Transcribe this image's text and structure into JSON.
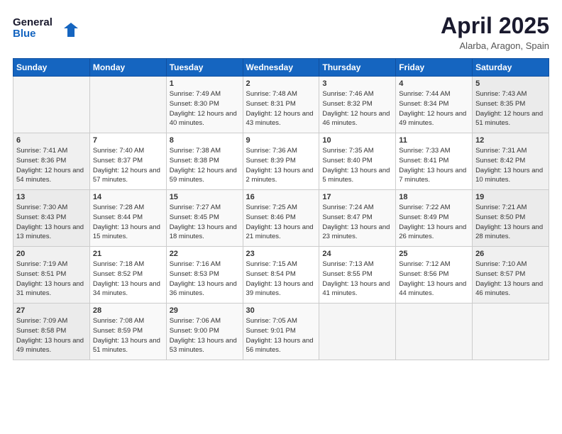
{
  "header": {
    "logo_line1": "General",
    "logo_line2": "Blue",
    "title": "April 2025",
    "subtitle": "Alarba, Aragon, Spain"
  },
  "days_of_week": [
    "Sunday",
    "Monday",
    "Tuesday",
    "Wednesday",
    "Thursday",
    "Friday",
    "Saturday"
  ],
  "weeks": [
    [
      {
        "num": "",
        "info": ""
      },
      {
        "num": "",
        "info": ""
      },
      {
        "num": "1",
        "info": "Sunrise: 7:49 AM\nSunset: 8:30 PM\nDaylight: 12 hours and 40 minutes."
      },
      {
        "num": "2",
        "info": "Sunrise: 7:48 AM\nSunset: 8:31 PM\nDaylight: 12 hours and 43 minutes."
      },
      {
        "num": "3",
        "info": "Sunrise: 7:46 AM\nSunset: 8:32 PM\nDaylight: 12 hours and 46 minutes."
      },
      {
        "num": "4",
        "info": "Sunrise: 7:44 AM\nSunset: 8:34 PM\nDaylight: 12 hours and 49 minutes."
      },
      {
        "num": "5",
        "info": "Sunrise: 7:43 AM\nSunset: 8:35 PM\nDaylight: 12 hours and 51 minutes."
      }
    ],
    [
      {
        "num": "6",
        "info": "Sunrise: 7:41 AM\nSunset: 8:36 PM\nDaylight: 12 hours and 54 minutes."
      },
      {
        "num": "7",
        "info": "Sunrise: 7:40 AM\nSunset: 8:37 PM\nDaylight: 12 hours and 57 minutes."
      },
      {
        "num": "8",
        "info": "Sunrise: 7:38 AM\nSunset: 8:38 PM\nDaylight: 12 hours and 59 minutes."
      },
      {
        "num": "9",
        "info": "Sunrise: 7:36 AM\nSunset: 8:39 PM\nDaylight: 13 hours and 2 minutes."
      },
      {
        "num": "10",
        "info": "Sunrise: 7:35 AM\nSunset: 8:40 PM\nDaylight: 13 hours and 5 minutes."
      },
      {
        "num": "11",
        "info": "Sunrise: 7:33 AM\nSunset: 8:41 PM\nDaylight: 13 hours and 7 minutes."
      },
      {
        "num": "12",
        "info": "Sunrise: 7:31 AM\nSunset: 8:42 PM\nDaylight: 13 hours and 10 minutes."
      }
    ],
    [
      {
        "num": "13",
        "info": "Sunrise: 7:30 AM\nSunset: 8:43 PM\nDaylight: 13 hours and 13 minutes."
      },
      {
        "num": "14",
        "info": "Sunrise: 7:28 AM\nSunset: 8:44 PM\nDaylight: 13 hours and 15 minutes."
      },
      {
        "num": "15",
        "info": "Sunrise: 7:27 AM\nSunset: 8:45 PM\nDaylight: 13 hours and 18 minutes."
      },
      {
        "num": "16",
        "info": "Sunrise: 7:25 AM\nSunset: 8:46 PM\nDaylight: 13 hours and 21 minutes."
      },
      {
        "num": "17",
        "info": "Sunrise: 7:24 AM\nSunset: 8:47 PM\nDaylight: 13 hours and 23 minutes."
      },
      {
        "num": "18",
        "info": "Sunrise: 7:22 AM\nSunset: 8:49 PM\nDaylight: 13 hours and 26 minutes."
      },
      {
        "num": "19",
        "info": "Sunrise: 7:21 AM\nSunset: 8:50 PM\nDaylight: 13 hours and 28 minutes."
      }
    ],
    [
      {
        "num": "20",
        "info": "Sunrise: 7:19 AM\nSunset: 8:51 PM\nDaylight: 13 hours and 31 minutes."
      },
      {
        "num": "21",
        "info": "Sunrise: 7:18 AM\nSunset: 8:52 PM\nDaylight: 13 hours and 34 minutes."
      },
      {
        "num": "22",
        "info": "Sunrise: 7:16 AM\nSunset: 8:53 PM\nDaylight: 13 hours and 36 minutes."
      },
      {
        "num": "23",
        "info": "Sunrise: 7:15 AM\nSunset: 8:54 PM\nDaylight: 13 hours and 39 minutes."
      },
      {
        "num": "24",
        "info": "Sunrise: 7:13 AM\nSunset: 8:55 PM\nDaylight: 13 hours and 41 minutes."
      },
      {
        "num": "25",
        "info": "Sunrise: 7:12 AM\nSunset: 8:56 PM\nDaylight: 13 hours and 44 minutes."
      },
      {
        "num": "26",
        "info": "Sunrise: 7:10 AM\nSunset: 8:57 PM\nDaylight: 13 hours and 46 minutes."
      }
    ],
    [
      {
        "num": "27",
        "info": "Sunrise: 7:09 AM\nSunset: 8:58 PM\nDaylight: 13 hours and 49 minutes."
      },
      {
        "num": "28",
        "info": "Sunrise: 7:08 AM\nSunset: 8:59 PM\nDaylight: 13 hours and 51 minutes."
      },
      {
        "num": "29",
        "info": "Sunrise: 7:06 AM\nSunset: 9:00 PM\nDaylight: 13 hours and 53 minutes."
      },
      {
        "num": "30",
        "info": "Sunrise: 7:05 AM\nSunset: 9:01 PM\nDaylight: 13 hours and 56 minutes."
      },
      {
        "num": "",
        "info": ""
      },
      {
        "num": "",
        "info": ""
      },
      {
        "num": "",
        "info": ""
      }
    ]
  ]
}
